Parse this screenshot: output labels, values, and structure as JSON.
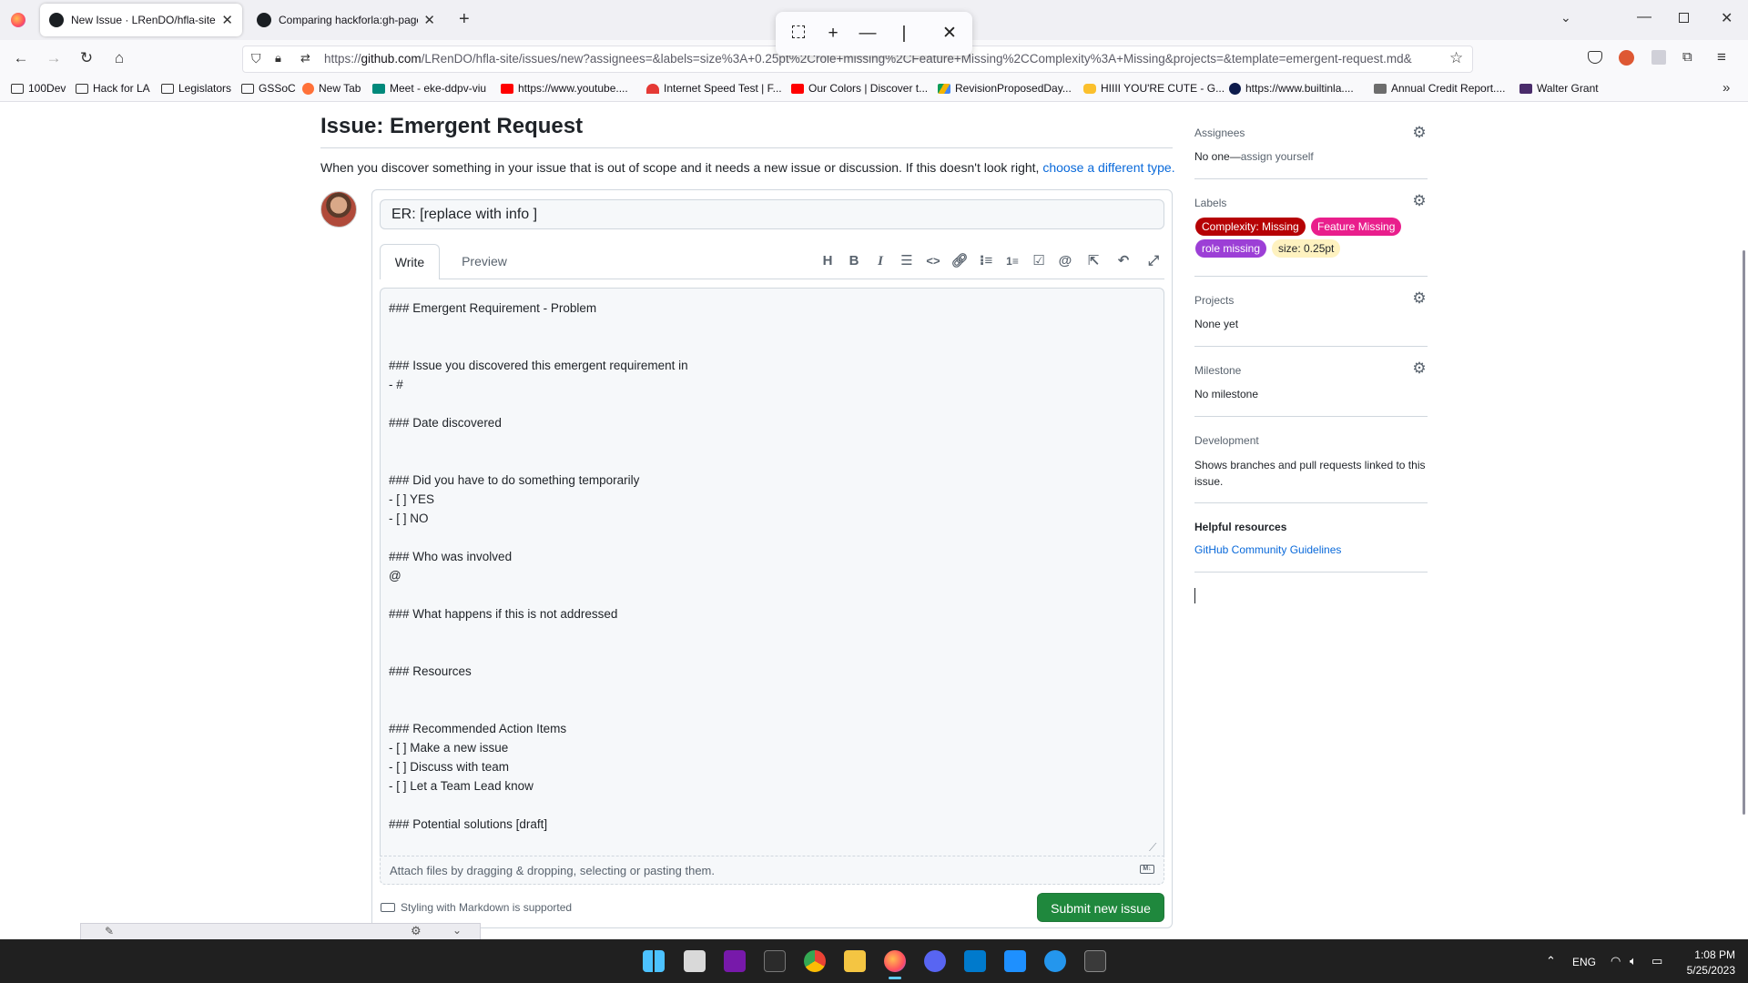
{
  "browser": {
    "tabs": [
      {
        "title": "New Issue · LRenDO/hfla-site"
      },
      {
        "title": "Comparing hackforla:gh-pages"
      }
    ],
    "url_domain": "github.com",
    "url_prefix": "https://",
    "url_rest": "/LRenDO/hfla-site/issues/new?assignees=&labels=size%3A+0.25pt%2Crole+missing%2CFeature+Missing%2CComplexity%3A+Missing&projects=&template=emergent-request.md&",
    "bookmarks": [
      {
        "label": "100Dev",
        "icon": "folder-icon"
      },
      {
        "label": "Hack for LA",
        "icon": "folder-icon"
      },
      {
        "label": "Legislators",
        "icon": "folder-icon"
      },
      {
        "label": "GSSoC",
        "icon": "folder-icon"
      },
      {
        "label": "New Tab",
        "icon": "firefox-icon"
      },
      {
        "label": "Meet - eke-ddpv-viu",
        "icon": "meet-icon"
      },
      {
        "label": "https://www.youtube....",
        "icon": "youtube-icon"
      },
      {
        "label": "Internet Speed Test | F...",
        "icon": "speed-icon"
      },
      {
        "label": "Our Colors | Discover t...",
        "icon": "youtube-icon"
      },
      {
        "label": "RevisionProposedDay...",
        "icon": "drive-icon"
      },
      {
        "label": "HIIII YOU'RE CUTE - G...",
        "icon": "hand-icon"
      },
      {
        "label": "https://www.builtinla....",
        "icon": "builtin-icon"
      },
      {
        "label": "Annual Credit Report....",
        "icon": "credit-icon"
      },
      {
        "label": "Walter Grant",
        "icon": "grant-icon"
      }
    ]
  },
  "issue": {
    "heading": "Issue: Emergent Request",
    "description": "When you discover something in your issue that is out of scope and it needs a new issue or discussion. If this doesn't look right, ",
    "description_link": "choose a different type.",
    "title_value": "ER: [replace with info ]",
    "tab_write": "Write",
    "tab_preview": "Preview",
    "body": "### Emergent Requirement - Problem\n\n\n### Issue you discovered this emergent requirement in\n- #\n\n### Date discovered\n\n\n### Did you have to do something temporarily\n- [ ] YES\n- [ ] NO\n\n### Who was involved\n@\n\n### What happens if this is not addressed\n\n\n### Resources\n\n\n### Recommended Action Items\n- [ ] Make a new issue\n- [ ] Discuss with team\n- [ ] Let a Team Lead know\n\n### Potential solutions [draft]",
    "attach_text": "Attach files by dragging & dropping, selecting or pasting them.",
    "markdown_note": "Styling with Markdown is supported",
    "submit_label": "Submit new issue"
  },
  "sidebar": {
    "assignees_heading": "Assignees",
    "assignees_none": "No one—",
    "assignees_link": "assign yourself",
    "labels_heading": "Labels",
    "labels": [
      {
        "name": "Complexity: Missing",
        "bg": "#b60205",
        "fg": "#ffffff"
      },
      {
        "name": "Feature Missing",
        "bg": "#e91e8c",
        "fg": "#ffffff"
      },
      {
        "name": "role missing",
        "bg": "#9c3fd6",
        "fg": "#ffffff"
      },
      {
        "name": "size: 0.25pt",
        "bg": "#fef2c0",
        "fg": "#1f2328"
      }
    ],
    "projects_heading": "Projects",
    "projects_value": "None yet",
    "milestone_heading": "Milestone",
    "milestone_value": "No milestone",
    "development_heading": "Development",
    "development_value": "Shows branches and pull requests linked to this issue.",
    "resources_heading": "Helpful resources",
    "resources_link": "GitHub Community Guidelines"
  },
  "taskbar": {
    "language": "ENG",
    "time": "1:08 PM",
    "date": "5/25/2023"
  },
  "colors": {
    "accent_link": "#0969da",
    "submit_green": "#1f883d"
  }
}
